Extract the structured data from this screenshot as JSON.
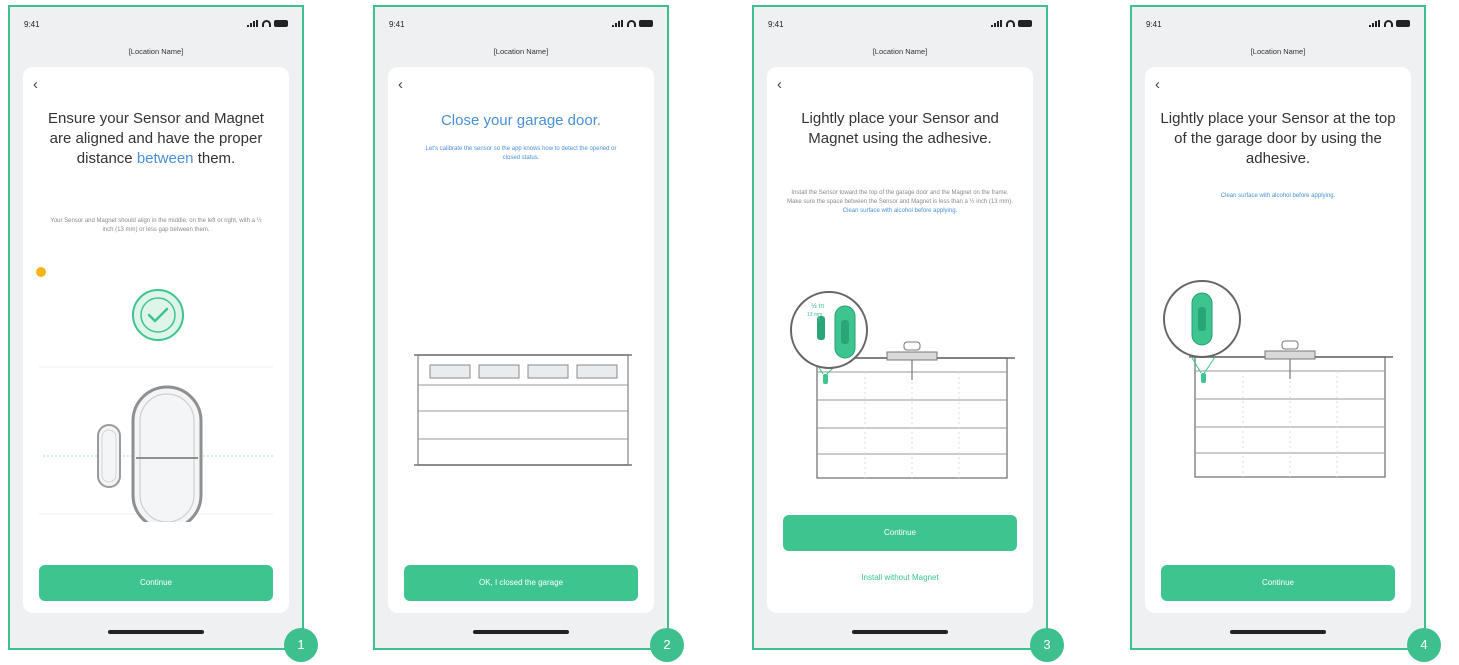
{
  "status_time": "9:41",
  "location_name": "[Location Name]",
  "colors": {
    "accent": "#3dc48f",
    "frame": "#3dbf8e",
    "link": "#4a90d9",
    "warning": "#f5b41b"
  },
  "icons": [
    "back-chevron-icon",
    "signal-icon",
    "wifi-icon",
    "battery-icon",
    "check-icon"
  ],
  "screens": [
    {
      "step": "1",
      "title_part1": "Ensure your Sensor and Magnet are aligned and have the proper distance ",
      "title_highlight": "between",
      "title_part2": " them.",
      "description": "Your Sensor and Magnet should align in the middle, on the left or right, with a ½ inch (13 mm) or less gap between them.",
      "button": "Continue"
    },
    {
      "step": "2",
      "title": "Close your garage door.",
      "description": "Let's calibrate the sensor so the app knows how to detect the opened or closed status.",
      "button": "OK, I closed the garage"
    },
    {
      "step": "3",
      "title": "Lightly place your Sensor and Magnet using the adhesive.",
      "description": "Install the Sensor toward the top of the garage door and the Magnet on the frame. Make sure the space between the Sensor and Magnet is less than a ½ inch (13 mm).",
      "description_link": "Clean surface with alcohol before applying.",
      "magnify_label_top": "½ in",
      "magnify_label_bottom": "13 mm",
      "button": "Continue",
      "secondary": "Install without Magnet"
    },
    {
      "step": "4",
      "title": "Lightly place your Sensor at the top of the garage door by using the adhesive.",
      "description": "Clean surface with alcohol before applying.",
      "button": "Continue"
    }
  ]
}
